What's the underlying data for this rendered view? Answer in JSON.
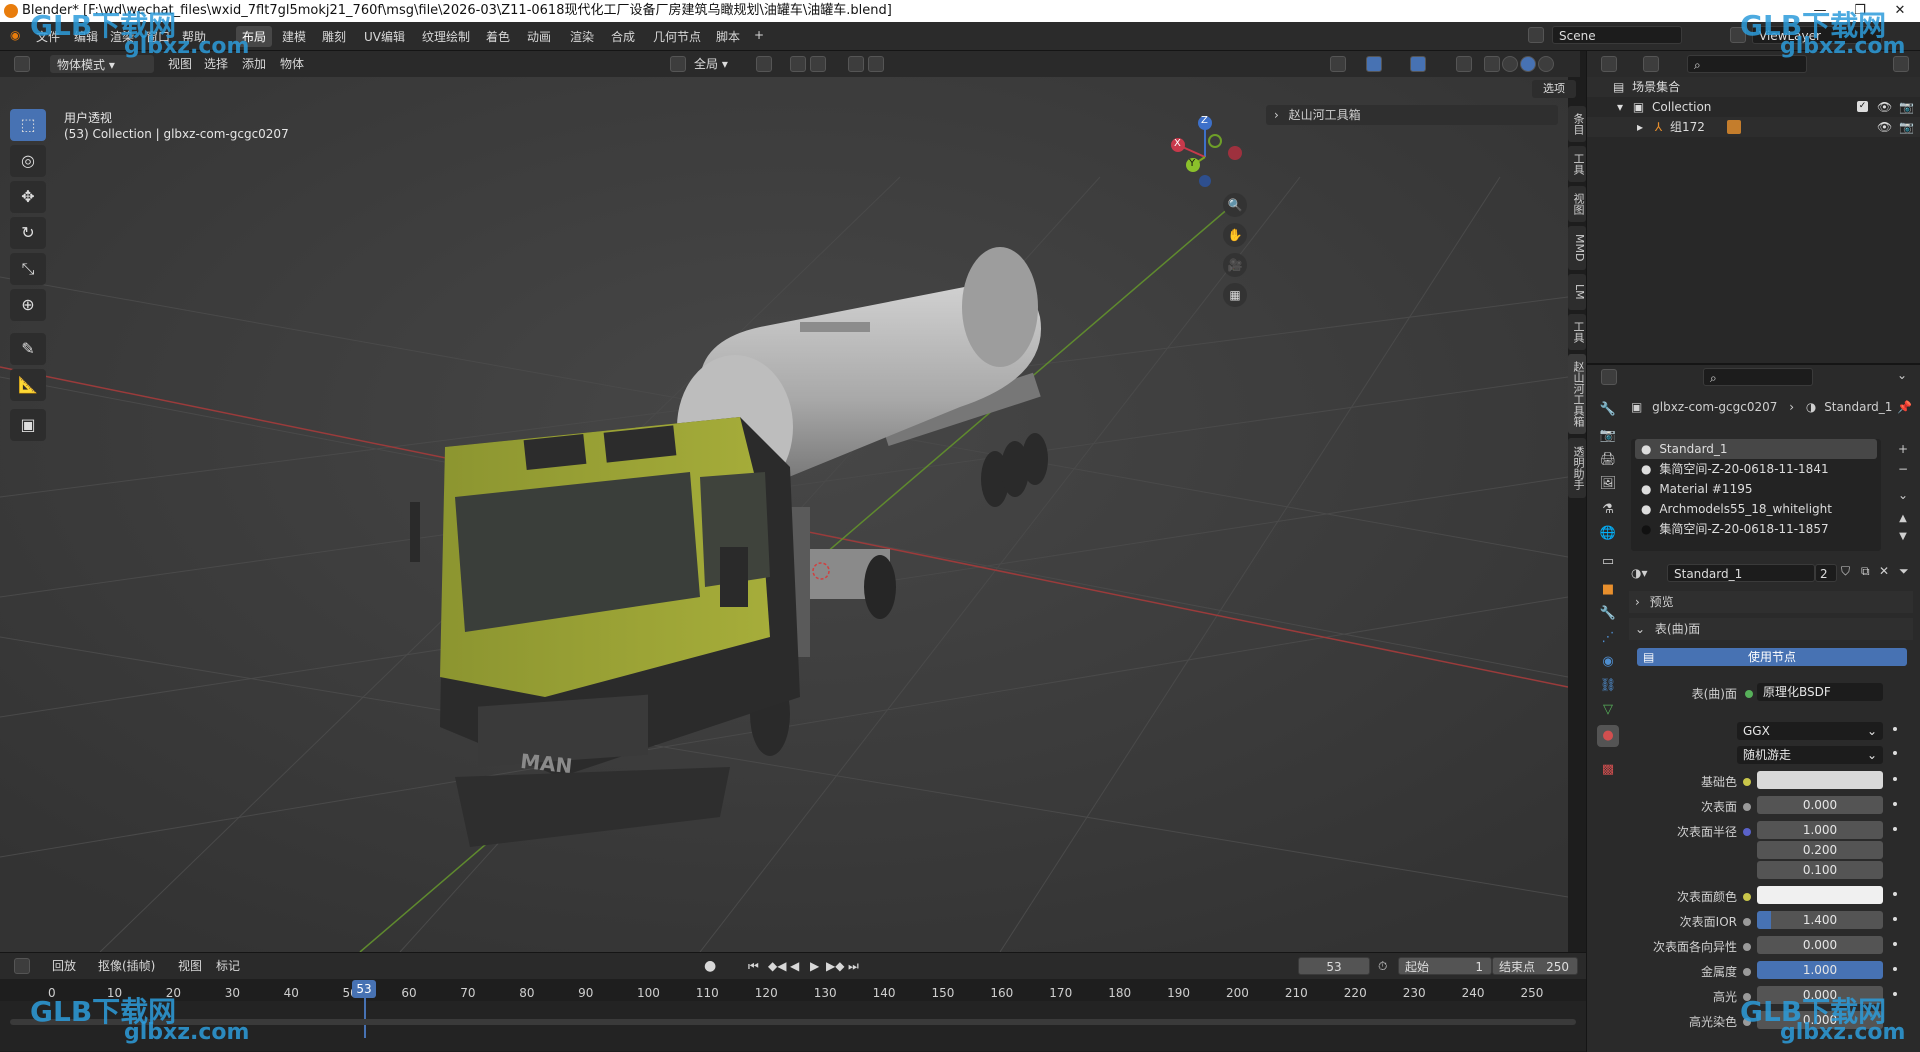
{
  "window": {
    "title": "Blender* [F:\\wd\\wechat_files\\wxid_7flt7gl5mokj21_760f\\msg\\file\\2026-03\\Z11-0618现代化工厂设备厂房建筑乌瞰规划\\油罐车\\油罐车.blend]",
    "min": "—",
    "max": "❐",
    "close": "✕"
  },
  "menubar": {
    "items": [
      "文件",
      "编辑",
      "渲染",
      "窗口",
      "帮助"
    ],
    "workspaces": [
      "布局",
      "建模",
      "雕刻",
      "UV编辑",
      "纹理绘制",
      "着色",
      "动画",
      "渲染",
      "合成",
      "几何节点",
      "脚本"
    ],
    "active_workspace": "布局",
    "add_tab": "+",
    "scene_label": "Scene",
    "viewlayer_label": "ViewLayer"
  },
  "viewport_header": {
    "mode": "物体模式",
    "menus": [
      "视图",
      "选择",
      "添加",
      "物体"
    ],
    "transform": "全局",
    "options": "选项"
  },
  "viewport": {
    "view_name": "用户透视",
    "collection_info": "(53) Collection | glbxz-com-gcgc0207",
    "toolbox_panel": "赵山河工具箱",
    "gizmo": {
      "z": "Z",
      "y": "Y",
      "x": "X"
    },
    "n_tabs": [
      "条目",
      "工具",
      "视图",
      "MMD",
      "LM",
      "工具",
      "赵山河工具箱",
      "透明助手"
    ]
  },
  "watermarks": {
    "logo": "GLB下载网",
    "url": "glbxz.com"
  },
  "outliner": {
    "root": "场景集合",
    "collection": "Collection",
    "object": "组172"
  },
  "properties": {
    "breadcrumb_object": "glbxz-com-gcgc0207",
    "breadcrumb_material": "Standard_1",
    "slots": [
      "Standard_1",
      "集简空间-Z-20-0618-11-1841",
      "Material #1195",
      "Archmodels55_18_whitelight",
      "集简空间-Z-20-0618-11-1857"
    ],
    "material_name": "Standard_1",
    "user_count": "2",
    "sections": {
      "preview": "预览",
      "surface": "表(曲)面"
    },
    "use_nodes": "使用节点",
    "surface_label": "表(曲)面",
    "surface_value": "原理化BSDF",
    "distribution": "GGX",
    "subsurface_method": "随机游走",
    "rows": [
      {
        "label": "基础色",
        "value": "",
        "type": "color-light"
      },
      {
        "label": "次表面",
        "value": "0.000",
        "type": "num"
      },
      {
        "label": "次表面半径",
        "value": "1.000",
        "type": "num"
      },
      {
        "label": "",
        "value": "0.200",
        "type": "num"
      },
      {
        "label": "",
        "value": "0.100",
        "type": "num"
      },
      {
        "label": "次表面颜色",
        "value": "",
        "type": "color-white"
      },
      {
        "label": "次表面IOR",
        "value": "1.400",
        "type": "num"
      },
      {
        "label": "次表面各向异性",
        "value": "0.000",
        "type": "num"
      },
      {
        "label": "金属度",
        "value": "1.000",
        "type": "blue"
      },
      {
        "label": "高光",
        "value": "0.000",
        "type": "num"
      },
      {
        "label": "高光染色",
        "value": "0.000",
        "type": "num"
      }
    ]
  },
  "timeline": {
    "menus": [
      "回放",
      "抠像(插帧)",
      "视图",
      "标记"
    ],
    "current_frame": "53",
    "start_label": "起始",
    "start": "1",
    "end_label": "结束点",
    "end": "250",
    "ticks": [
      "0",
      "10",
      "20",
      "30",
      "40",
      "50",
      "60",
      "70",
      "80",
      "90",
      "100",
      "110",
      "120",
      "130",
      "140",
      "150",
      "160",
      "170",
      "180",
      "190",
      "200",
      "210",
      "220",
      "230",
      "240",
      "250"
    ]
  },
  "colors": {
    "accent": "#4772b3",
    "truck_cab": "#9aa333",
    "tank": "#b4b4b4"
  }
}
